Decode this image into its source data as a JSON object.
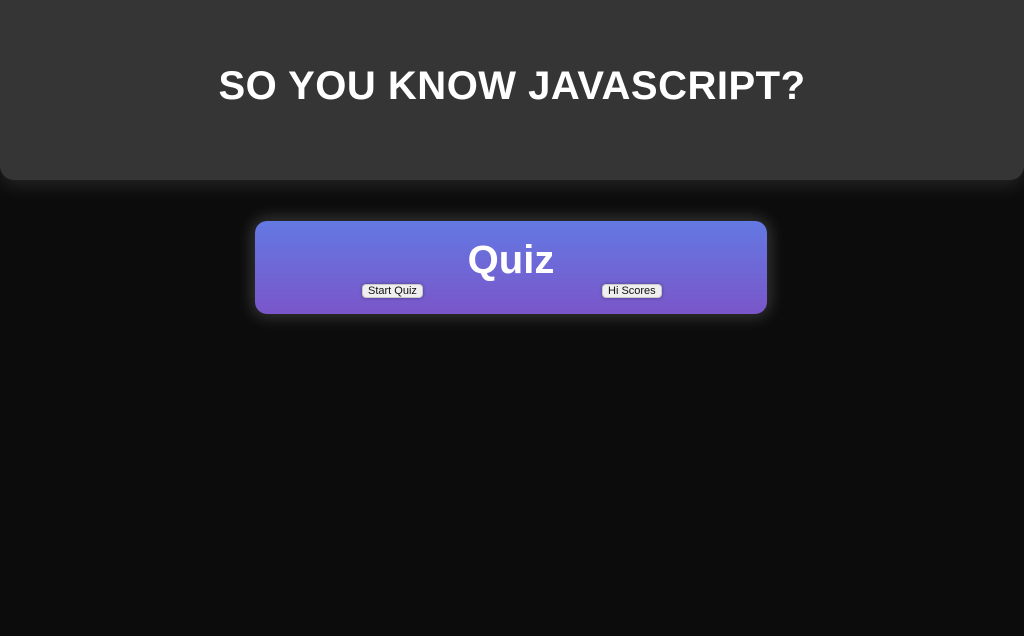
{
  "header": {
    "title": "SO YOU KNOW JAVASCRIPT?"
  },
  "quiz_card": {
    "title": "Quiz",
    "start_button_label": "Start Quiz",
    "hi_scores_button_label": "Hi Scores"
  },
  "colors": {
    "page_background": "#0c0c0c",
    "header_background": "#353535",
    "card_gradient_top": "#6379e3",
    "card_gradient_bottom": "#7a56c9"
  }
}
